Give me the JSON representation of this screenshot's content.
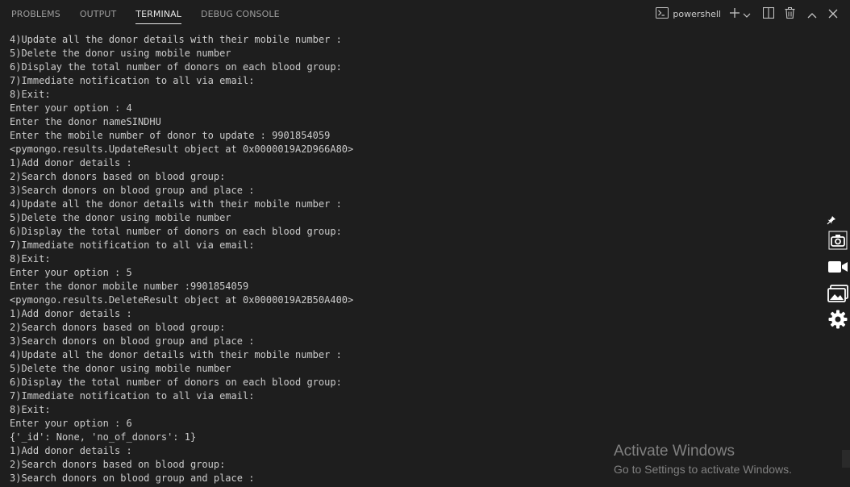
{
  "tabs": [
    {
      "label": "PROBLEMS",
      "active": false
    },
    {
      "label": "OUTPUT",
      "active": false
    },
    {
      "label": "TERMINAL",
      "active": true
    },
    {
      "label": "DEBUG CONSOLE",
      "active": false
    }
  ],
  "actions": {
    "terminal_name": "powershell",
    "terminal_icon": "terminal-icon",
    "new_terminal_icon": "plus-icon",
    "dropdown_icon": "chevron-down-icon",
    "split_icon": "split-icon",
    "kill_icon": "trash-icon",
    "maximize_icon": "chevron-up-icon",
    "close_icon": "close-icon"
  },
  "terminal": {
    "lines": [
      "4)Update all the donor details with their mobile number :",
      "5)Delete the donor using mobile number",
      "6)Display the total number of donors on each blood group:",
      "7)Immediate notification to all via email:",
      "8)Exit:",
      "Enter your option : 4",
      "Enter the donor nameSINDHU",
      "Enter the mobile number of donor to update : 9901854059",
      "<pymongo.results.UpdateResult object at 0x0000019A2D966A80>",
      "1)Add donor details :",
      "2)Search donors based on blood group:",
      "3)Search donors on blood group and place :",
      "4)Update all the donor details with their mobile number :",
      "5)Delete the donor using mobile number",
      "6)Display the total number of donors on each blood group:",
      "7)Immediate notification to all via email:",
      "8)Exit:",
      "Enter your option : 5",
      "Enter the donor mobile number :9901854059",
      "<pymongo.results.DeleteResult object at 0x0000019A2B50A400>",
      "1)Add donor details :",
      "2)Search donors based on blood group:",
      "3)Search donors on blood group and place :",
      "4)Update all the donor details with their mobile number :",
      "5)Delete the donor using mobile number",
      "6)Display the total number of donors on each blood group:",
      "7)Immediate notification to all via email:",
      "8)Exit:",
      "Enter your option : 6",
      "{'_id': None, 'no_of_donors': 1}",
      "1)Add donor details :",
      "2)Search donors based on blood group:",
      "3)Search donors on blood group and place :"
    ]
  },
  "watermark": {
    "title": "Activate Windows",
    "subtitle": "Go to Settings to activate Windows."
  },
  "side_toolbar": {
    "items": [
      "pin-icon",
      "camera-icon",
      "video-icon",
      "gallery-icon",
      "settings-icon"
    ]
  }
}
